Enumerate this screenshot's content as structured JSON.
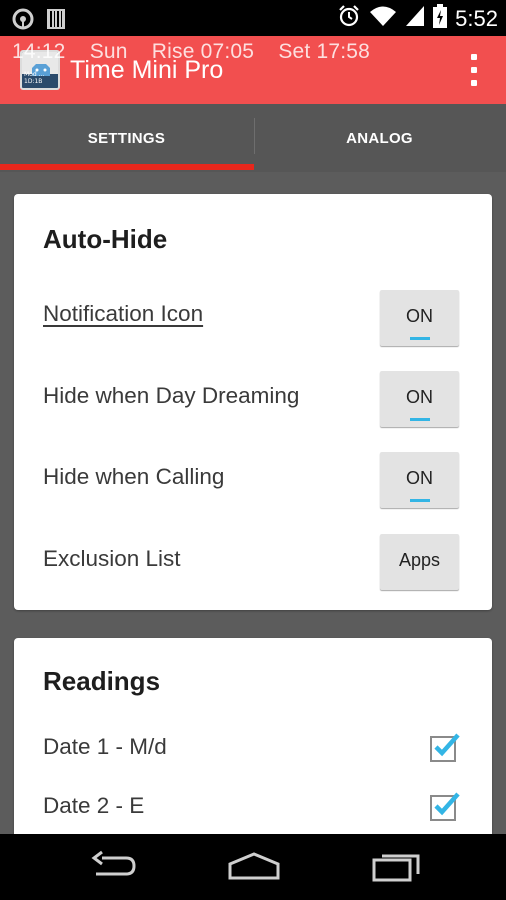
{
  "status_bar": {
    "time": "5:52",
    "icons": [
      "circle-notification-icon",
      "barcode-icon",
      "alarm-icon",
      "wifi-icon",
      "signal-icon",
      "battery-charging-icon"
    ]
  },
  "app_bar": {
    "ticker": "14:12    Sun    Rise 07:05    Set 17:58",
    "title": "Time Mini Pro",
    "icon_text": "Mod ... 1D:1B",
    "icon_badge": "2.5C"
  },
  "tabs": [
    {
      "label": "SETTINGS",
      "selected": true
    },
    {
      "label": "ANALOG",
      "selected": false
    }
  ],
  "auto_hide": {
    "title": "Auto-Hide",
    "rows": [
      {
        "label": "Notification Icon",
        "button": "ON"
      },
      {
        "label": "Hide when Day Dreaming",
        "button": "ON"
      },
      {
        "label": "Hide when Calling",
        "button": "ON"
      },
      {
        "label": "Exclusion List",
        "button": "Apps"
      }
    ]
  },
  "readings": {
    "title": "Readings",
    "rows": [
      {
        "label": "Date 1 - M/d",
        "checked": true
      },
      {
        "label": "Date 2 - E",
        "checked": true
      }
    ]
  },
  "colors": {
    "accent": "#f24f4f",
    "tab_indicator": "#e8271c",
    "holo_blue": "#33b5e5"
  },
  "nav_bar": {
    "icons": [
      "back-icon",
      "home-icon",
      "recents-icon"
    ]
  }
}
